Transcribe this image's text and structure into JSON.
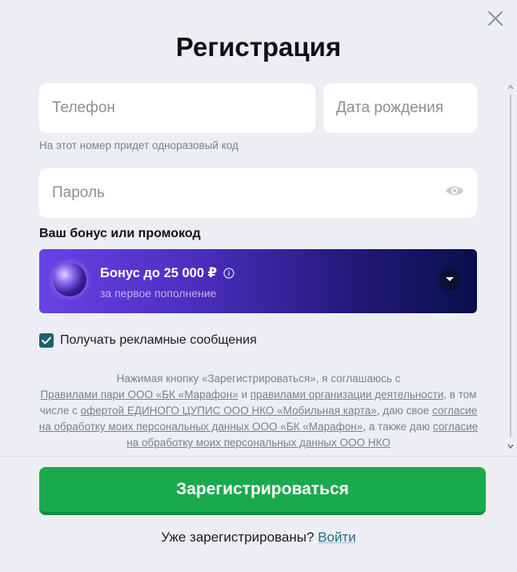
{
  "modal": {
    "title": "Регистрация",
    "close_icon": "close-icon"
  },
  "form": {
    "phone": {
      "placeholder": "Телефон"
    },
    "birthdate": {
      "placeholder": "Дата рождения"
    },
    "phone_hint": "На этот номер придет одноразовый код",
    "password": {
      "placeholder": "Пароль",
      "icon": "eye-icon"
    }
  },
  "bonus": {
    "label": "Ваш бонус или промокод",
    "title": "Бонус до 25 000 ₽",
    "subtitle": "за первое пополнение",
    "info_icon": "info-icon",
    "dropdown_icon": "chevron-down-icon",
    "colors": {
      "start": "#6a42e6",
      "end": "#08104a"
    }
  },
  "consent": {
    "checked": true,
    "label": "Получать рекламные сообщения"
  },
  "legal": {
    "p1": "Нажимая кнопку «Зарегистрироваться», я соглашаюсь с",
    "p2": "Правилами пари ООО «БК «Марафон»",
    "p3": " и ",
    "p4": "правилами организации деятельности",
    "p5": ", в том числе с ",
    "p6": "офертой ЕДИНОГО ЦУПИС ООО НКО «Мобильная карта»",
    "p7": ", даю свое ",
    "p8": "согласие на обработку моих персональных данных ООО «БК «Марафон»",
    "p9": ", а также даю ",
    "p10": "согласие на обработку моих персональных данных ООО НКО"
  },
  "actions": {
    "register_label": "Зарегистрироваться",
    "already_text": "Уже зарегистрированы?",
    "login_label": "Войти",
    "register_color": "#1aaa4e"
  }
}
